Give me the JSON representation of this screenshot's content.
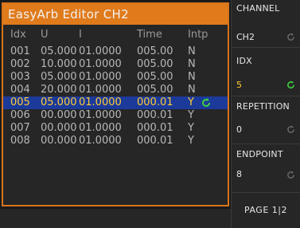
{
  "editor": {
    "title": "EasyArb Editor CH2",
    "headers": {
      "idx": "Idx",
      "u": "U",
      "i": "I",
      "time": "Time",
      "intp": "Intp"
    },
    "rows": [
      {
        "idx": "001",
        "u": "05.000",
        "i": "01.0000",
        "time": "005.00",
        "intp": "N",
        "selected": false
      },
      {
        "idx": "002",
        "u": "10.000",
        "i": "01.0000",
        "time": "005.00",
        "intp": "N",
        "selected": false
      },
      {
        "idx": "003",
        "u": "05.000",
        "i": "01.0000",
        "time": "005.00",
        "intp": "N",
        "selected": false
      },
      {
        "idx": "004",
        "u": "20.000",
        "i": "01.0000",
        "time": "005.00",
        "intp": "N",
        "selected": false
      },
      {
        "idx": "005",
        "u": "05.000",
        "i": "01.0000",
        "time": "000.01",
        "intp": "Y",
        "selected": true
      },
      {
        "idx": "006",
        "u": "00.000",
        "i": "01.0000",
        "time": "000.01",
        "intp": "Y",
        "selected": false
      },
      {
        "idx": "007",
        "u": "00.000",
        "i": "01.0000",
        "time": "000.01",
        "intp": "Y",
        "selected": false
      },
      {
        "idx": "008",
        "u": "00.000",
        "i": "01.0000",
        "time": "000.01",
        "intp": "Y",
        "selected": false
      }
    ]
  },
  "softkeys": {
    "channel": {
      "label": "CHANNEL",
      "value": "CH2"
    },
    "idx": {
      "label": "IDX",
      "value": "5"
    },
    "repetition": {
      "label": "REPETITION",
      "value": "0"
    },
    "endpoint": {
      "label": "ENDPOINT",
      "value": "8"
    },
    "page": {
      "label": "PAGE 1|2"
    }
  },
  "colors": {
    "accent_orange": "#e07b1c",
    "selection_blue": "#1c3a9a",
    "active_yellow": "#ffcc33",
    "knob_green": "#3fcf3f",
    "knob_gray": "#6a6a6a"
  },
  "icons": {
    "knob": "rotary-knob-icon"
  }
}
